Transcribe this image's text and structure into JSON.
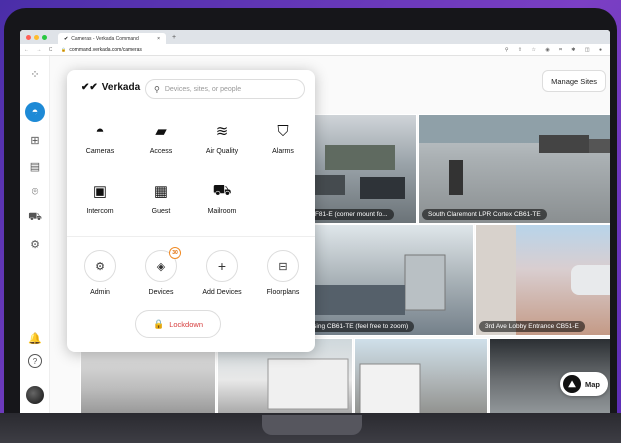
{
  "browser": {
    "tab_title": "Cameras - Verkada Command",
    "tab_close": "×",
    "new_tab": "+",
    "nav_buttons": "← → C",
    "lock": "🔒",
    "url": "command.verkada.com/cameras",
    "toolbar_icons": "⚲ ⇧ ☆ ◉ ⌗ ✱ ◫ ●"
  },
  "sidebar": {
    "items": [
      {
        "icon": "grid-pattern-icon",
        "glyph": "⁘"
      },
      {
        "icon": "camera-icon",
        "glyph": "◓",
        "active": true
      },
      {
        "icon": "floorplan-icon",
        "glyph": "⊞"
      },
      {
        "icon": "archive-icon",
        "glyph": "▤"
      },
      {
        "icon": "person-scan-icon",
        "glyph": "⌾"
      },
      {
        "icon": "vehicle-icon",
        "glyph": "⛟"
      },
      {
        "icon": "settings-icon",
        "glyph": "⚙"
      },
      {
        "icon": "bell-icon",
        "glyph": "🔔"
      },
      {
        "icon": "help-icon",
        "glyph": "?"
      }
    ]
  },
  "header": {
    "manage_sites_label": "Manage Sites"
  },
  "feeds": [
    {
      "caption": ""
    },
    {
      "caption": "mont CF81-E (corner mount fo..."
    },
    {
      "caption": "South Claremont LPR Cortex CB61-TE"
    },
    {
      "caption": ""
    },
    {
      "caption": "d Crossing CB61-TE (feel free to zoom)"
    },
    {
      "caption": "3rd Ave Lobby Entrance CB51-E"
    },
    {
      "caption": ""
    },
    {
      "caption": ""
    },
    {
      "caption": ""
    },
    {
      "caption": ""
    }
  ],
  "map_button": {
    "label": "Map",
    "glyph": "⛰"
  },
  "popup": {
    "brand": "Verkada",
    "brand_logo": "✔✔",
    "search_icon": "⚲",
    "search_placeholder": "Devices, sites, or people",
    "products": [
      {
        "label": "Cameras",
        "glyph": "◓"
      },
      {
        "label": "Access",
        "glyph": "▰"
      },
      {
        "label": "Air Quality",
        "glyph": "≋"
      },
      {
        "label": "Alarms",
        "glyph": "⛉"
      },
      {
        "label": "Intercom",
        "glyph": "▣"
      },
      {
        "label": "Guest",
        "glyph": "▦"
      },
      {
        "label": "Mailroom",
        "glyph": "⛟"
      }
    ],
    "tools": [
      {
        "label": "Admin",
        "glyph": "⚙"
      },
      {
        "label": "Devices",
        "glyph": "◈",
        "badge": "30"
      },
      {
        "label": "Add Devices",
        "glyph": "+"
      },
      {
        "label": "Floorplans",
        "glyph": "⊟"
      }
    ],
    "lockdown_label": "Lockdown",
    "lockdown_glyph": "🔒"
  }
}
